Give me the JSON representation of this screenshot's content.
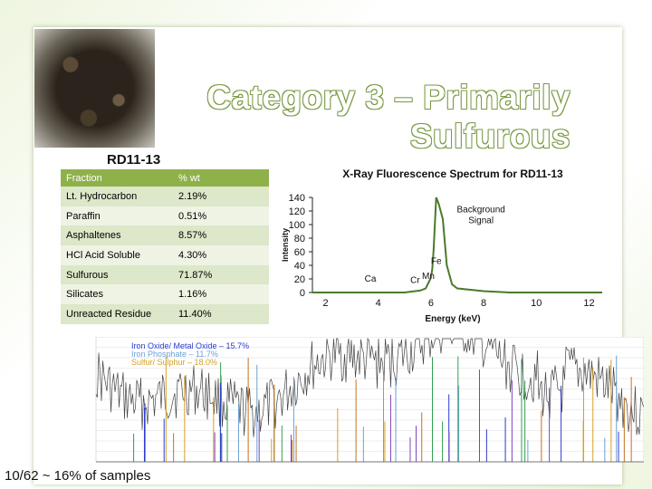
{
  "slide": {
    "title_line1": "Category 3 – Primarily",
    "title_line2": "Sulfurous",
    "sample_id": "RD11-13",
    "footer_note": "10/62 ~ 16% of samples"
  },
  "fraction_table": {
    "headers": [
      "Fraction",
      "% wt"
    ],
    "rows": [
      {
        "name": "Lt. Hydrocarbon",
        "value": "2.19%"
      },
      {
        "name": "Paraffin",
        "value": "0.51%"
      },
      {
        "name": "Asphaltenes",
        "value": "8.57%"
      },
      {
        "name": "HCl Acid Soluble",
        "value": "4.30%"
      },
      {
        "name": "Sulfurous",
        "value": "71.87%"
      },
      {
        "name": "Silicates",
        "value": "1.16%"
      },
      {
        "name": "Unreacted Residue",
        "value": "11.40%"
      }
    ]
  },
  "chart_data": [
    {
      "type": "line",
      "title": "X-Ray Fluorescence Spectrum for RD11-13",
      "xlabel": "Energy (keV)",
      "ylabel": "Intensity",
      "xlim": [
        1.5,
        12.5
      ],
      "ylim": [
        0,
        140
      ],
      "x_ticks": [
        2,
        4,
        6,
        8,
        10,
        12
      ],
      "y_ticks": [
        0,
        20,
        40,
        60,
        80,
        100,
        120,
        140
      ],
      "grid": false,
      "color": "#4a7a2a",
      "x": [
        1.5,
        2.0,
        2.5,
        3.0,
        3.3,
        3.6,
        4.0,
        4.5,
        5.0,
        5.2,
        5.4,
        5.6,
        5.8,
        5.95,
        6.0,
        6.05,
        6.1,
        6.2,
        6.3,
        6.45,
        6.6,
        6.8,
        7.0,
        7.5,
        8.0,
        8.5,
        9.0,
        10.0,
        11.0,
        12.5
      ],
      "y": [
        0,
        0,
        0,
        0,
        0,
        0,
        0,
        0,
        0,
        1,
        2,
        3,
        6,
        18,
        22,
        35,
        62,
        140,
        130,
        108,
        40,
        12,
        6,
        4,
        2,
        1,
        0,
        0,
        0,
        0
      ],
      "annotations": [
        {
          "text": "Background Signal",
          "x": 7.9,
          "y": 118
        },
        {
          "text": "Ca",
          "x": 3.7,
          "y": 16
        },
        {
          "text": "Cr",
          "x": 5.4,
          "y": 14
        },
        {
          "text": "Mn",
          "x": 5.9,
          "y": 20
        },
        {
          "text": "Fe",
          "x": 6.2,
          "y": 42
        }
      ]
    },
    {
      "type": "line",
      "title": "",
      "xlabel": "",
      "ylabel": "",
      "xlim": [
        0,
        1
      ],
      "ylim": [
        0,
        1
      ],
      "grid": true,
      "legend": [
        {
          "text": "Iron Oxide/ Metal Oxide – 15.7%",
          "colors": [
            "#2a3ad0",
            "#c87020"
          ]
        },
        {
          "text": "Iron Phosphate – 11.7%",
          "colors": [
            "#6aa0d8"
          ]
        },
        {
          "text": "Sulfur/ Sulphur – 18.0%",
          "colors": [
            "#d8a020",
            "#8040c0"
          ]
        }
      ]
    }
  ]
}
